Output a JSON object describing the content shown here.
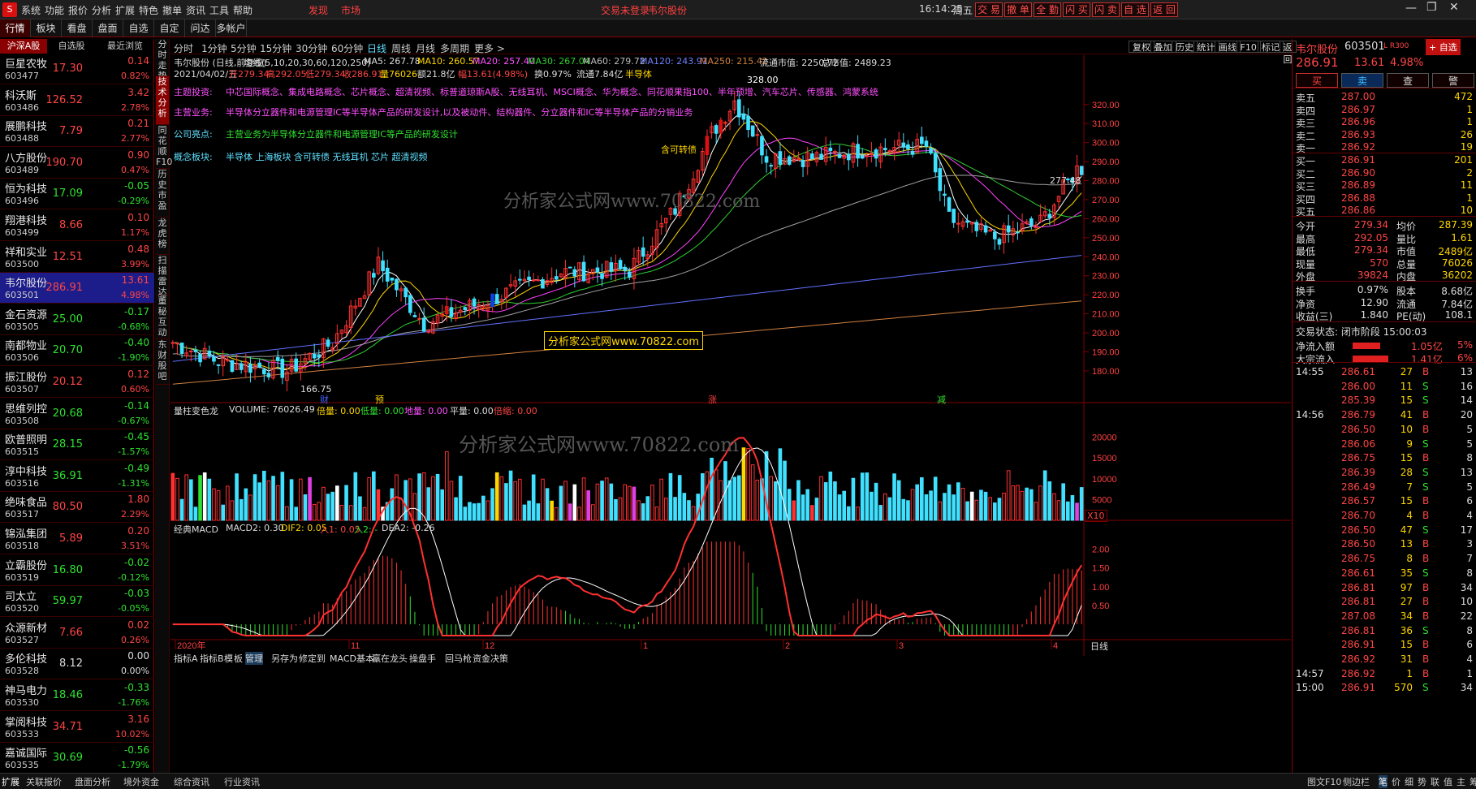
{
  "menu": {
    "items": [
      "系统",
      "功能",
      "报价",
      "分析",
      "扩展",
      "特色",
      "撤单",
      "资讯",
      "工具",
      "帮助"
    ],
    "discover": "发现",
    "market": "市场",
    "login": "交易未登录",
    "stock": "韦尔股份",
    "time": "16:14:25",
    "weekday": "周五",
    "actions": [
      "交 易",
      "撤 单",
      "全 勤",
      "闪 买",
      "闪 卖",
      "自 选",
      "返 回"
    ]
  },
  "tabs": [
    "行情",
    "板块",
    "看盘",
    "盘面",
    "自选",
    "自定",
    "问达",
    "多帐户"
  ],
  "left": {
    "headers": [
      "沪深A股",
      "自选股",
      "最近浏览"
    ],
    "stocks": [
      {
        "name": "巨星农牧",
        "code": "603477",
        "price": "17.30",
        "chg": "0.14",
        "pct": "0.82%",
        "dir": "up"
      },
      {
        "name": "科沃斯",
        "code": "603486",
        "price": "126.52",
        "chg": "3.42",
        "pct": "2.78%",
        "dir": "up"
      },
      {
        "name": "展鹏科技",
        "code": "603488",
        "price": "7.79",
        "chg": "0.21",
        "pct": "2.77%",
        "dir": "up"
      },
      {
        "name": "八方股份",
        "code": "603489",
        "price": "190.70",
        "chg": "0.90",
        "pct": "0.47%",
        "dir": "up"
      },
      {
        "name": "恒为科技",
        "code": "603496",
        "price": "17.09",
        "chg": "-0.05",
        "pct": "-0.29%",
        "dir": "dn"
      },
      {
        "name": "翔港科技",
        "code": "603499",
        "price": "8.66",
        "chg": "0.10",
        "pct": "1.17%",
        "dir": "up"
      },
      {
        "name": "祥和实业",
        "code": "603500",
        "price": "12.51",
        "chg": "0.48",
        "pct": "3.99%",
        "dir": "up"
      },
      {
        "name": "韦尔股份",
        "code": "603501",
        "price": "286.91",
        "chg": "13.61",
        "pct": "4.98%",
        "dir": "up"
      },
      {
        "name": "金石资源",
        "code": "603505",
        "price": "25.00",
        "chg": "-0.17",
        "pct": "-0.68%",
        "dir": "dn"
      },
      {
        "name": "南都物业",
        "code": "603506",
        "price": "20.70",
        "chg": "-0.40",
        "pct": "-1.90%",
        "dir": "dn"
      },
      {
        "name": "振江股份",
        "code": "603507",
        "price": "20.12",
        "chg": "0.12",
        "pct": "0.60%",
        "dir": "up"
      },
      {
        "name": "思维列控",
        "code": "603508",
        "price": "20.68",
        "chg": "-0.14",
        "pct": "-0.67%",
        "dir": "dn"
      },
      {
        "name": "欧普照明",
        "code": "603515",
        "price": "28.15",
        "chg": "-0.45",
        "pct": "-1.57%",
        "dir": "dn"
      },
      {
        "name": "淳中科技",
        "code": "603516",
        "price": "36.91",
        "chg": "-0.49",
        "pct": "-1.31%",
        "dir": "dn"
      },
      {
        "name": "绝味食品",
        "code": "603517",
        "price": "80.50",
        "chg": "1.80",
        "pct": "2.29%",
        "dir": "up"
      },
      {
        "name": "锦泓集团",
        "code": "603518",
        "price": "5.89",
        "chg": "0.20",
        "pct": "3.51%",
        "dir": "up"
      },
      {
        "name": "立霸股份",
        "code": "603519",
        "price": "16.80",
        "chg": "-0.02",
        "pct": "-0.12%",
        "dir": "dn"
      },
      {
        "name": "司太立",
        "code": "603520",
        "price": "59.97",
        "chg": "-0.03",
        "pct": "-0.05%",
        "dir": "dn"
      },
      {
        "name": "众源新材",
        "code": "603527",
        "price": "7.66",
        "chg": "0.02",
        "pct": "0.26%",
        "dir": "up"
      },
      {
        "name": "多伦科技",
        "code": "603528",
        "price": "8.12",
        "chg": "0.00",
        "pct": "0.00%",
        "dir": "wh"
      },
      {
        "name": "神马电力",
        "code": "603530",
        "price": "18.46",
        "chg": "-0.33",
        "pct": "-1.76%",
        "dir": "dn"
      },
      {
        "name": "掌阅科技",
        "code": "603533",
        "price": "34.71",
        "chg": "3.16",
        "pct": "10.02%",
        "dir": "up"
      },
      {
        "name": "嘉诚国际",
        "code": "603535",
        "price": "30.69",
        "chg": "-0.56",
        "pct": "-1.79%",
        "dir": "dn"
      }
    ]
  },
  "vtabs": [
    "分时走势",
    "技术分析",
    "同花顺F10",
    "历史市盈",
    "龙虎榜",
    "扫描雷达",
    "董秘互动",
    "东财股吧"
  ],
  "period": {
    "items": [
      "分时",
      "1分钟",
      "5分钟",
      "15分钟",
      "30分钟",
      "60分钟",
      "日线",
      "周线",
      "月线",
      "多周期",
      "更多 >"
    ],
    "selected": "日线",
    "right": [
      "复权",
      "叠加",
      "历史",
      "统计",
      "画线",
      "F10",
      "标记",
      "返回"
    ]
  },
  "info": {
    "line1_name": "韦尔股份 (日线,前复权)",
    "ma_label": "均线(5,10,20,30,60,120,250)",
    "ma5": "MA5: 267.78",
    "ma10": "MA10: 260.57",
    "ma20": "MA20: 257.40",
    "ma30": "MA30: 267.04",
    "ma60": "MA60: 279.72",
    "ma120": "MA120: 243.91",
    "ma250": "MA250: 215.42",
    "cap1": "流通市值: 2250.72",
    "cap2": "总市值: 2489.23",
    "line2": "2021/04/02/五",
    "open": "开279.34",
    "high": "高292.05",
    "low": "低279.34",
    "close": "收286.91",
    "vol": "量76026",
    "amt": "额21.8亿",
    "rng": "幅13.61(4.98%)",
    "turn": "换0.97%",
    "float": "流通7.84亿",
    "sector": "半导体"
  },
  "notes": [
    {
      "label": "主题投资:",
      "text": "中芯国际概念、集成电路概念、芯片概念、超清视频、标普道琼斯A股、无线耳机、MSCI概念、华为概念、同花顺果指100、半年预增、汽车芯片、传感器、鸿蒙系统"
    },
    {
      "label": "主营业务:",
      "text": "半导体分立器件和电源管理IC等半导体产品的研发设计,以及被动件、结构器件、分立器件和IC等半导体产品的分销业务"
    },
    {
      "label": "公司亮点:",
      "text": "主营业务为半导体分立器件和电源管理IC等产品的研发设计"
    },
    {
      "label": "概念板块:",
      "text": "半导体 上海板块 含可转债 无线耳机 芯片 超清视频"
    }
  ],
  "chart_marks": {
    "high": "328.00",
    "low": "166.75",
    "last": "277.48",
    "convertible": "含可转债",
    "watermark1": "分析家公式网www.70822.com",
    "watermark2": "分析家公式网www.70822.com",
    "watermark3": "分析家公式网www.70822.com",
    "events": [
      "财",
      "预",
      "涨",
      "减"
    ]
  },
  "price_axis": [
    "320.00",
    "310.00",
    "300.00",
    "290.00",
    "280.00",
    "270.00",
    "260.00",
    "250.00",
    "240.00",
    "230.00",
    "220.00",
    "210.00",
    "200.00",
    "190.00",
    "180.00"
  ],
  "vol_info": {
    "title": "量柱变色龙",
    "volume": "VOLUME: 76026.49",
    "bei": "倍量: 0.00",
    "di": "低量: 0.00",
    "di2": "地量: 0.00",
    "ping": "平量: 0.00",
    "bei2": "倍缩: 0.00",
    "axis": [
      "20000",
      "15000",
      "10000",
      "5000"
    ],
    "unit": "X10"
  },
  "macd_info": {
    "title": "经典MACD",
    "macd2": "MACD2: 0.30",
    "dif2": "DIF2: 0.05",
    "ru1": "入1: 0.05",
    "ru2": "入2: -",
    "dea2": "DEA2: -0.26",
    "axis": [
      "2.00",
      "1.50",
      "1.00",
      "0.50"
    ]
  },
  "x_axis": {
    "labels": [
      "2020年",
      "11",
      "12",
      "1",
      "2",
      "3",
      "4"
    ],
    "period": "日线"
  },
  "bottom_tabs": [
    "指标A",
    "指标B",
    "模",
    "板",
    "管理",
    "另存为",
    "修定到",
    "MACD基本",
    "羸在龙头",
    "操盘手",
    "回马枪",
    "资金决策"
  ],
  "right": {
    "name": "韦尔股份",
    "code": "603501",
    "flag": "L R300",
    "add": "+ 自选",
    "price": "286.91",
    "chg": "13.61",
    "pct": "4.98%",
    "btns": [
      "买",
      "卖",
      "查",
      "警"
    ],
    "asks": [
      {
        "l": "卖五",
        "p": "287.00",
        "v": "472"
      },
      {
        "l": "卖四",
        "p": "286.97",
        "v": "1"
      },
      {
        "l": "卖三",
        "p": "286.96",
        "v": "1"
      },
      {
        "l": "卖二",
        "p": "286.93",
        "v": "26"
      },
      {
        "l": "卖一",
        "p": "286.92",
        "v": "19"
      }
    ],
    "bids": [
      {
        "l": "买一",
        "p": "286.91",
        "v": "201"
      },
      {
        "l": "买二",
        "p": "286.90",
        "v": "2"
      },
      {
        "l": "买三",
        "p": "286.89",
        "v": "11"
      },
      {
        "l": "买四",
        "p": "286.88",
        "v": "1"
      },
      {
        "l": "买五",
        "p": "286.86",
        "v": "10"
      }
    ],
    "stats": [
      [
        "今开",
        "279.34",
        "均价",
        "287.39"
      ],
      [
        "最高",
        "292.05",
        "量比",
        "1.61"
      ],
      [
        "最低",
        "279.34",
        "市值",
        "2489亿"
      ],
      [
        "现量",
        "570",
        "总量",
        "76026"
      ],
      [
        "外盘",
        "39824",
        "内盘",
        "36202"
      ]
    ],
    "stats2": [
      [
        "换手",
        "0.97%",
        "股本",
        "8.68亿"
      ],
      [
        "净资",
        "12.90",
        "流通",
        "7.84亿"
      ],
      [
        "收益(三)",
        "1.840",
        "PE(动)",
        "108.1"
      ]
    ],
    "state": "交易状态: 闭市阶段 15:00:03",
    "flow": [
      {
        "l": "净流入额",
        "v": "1.05亿",
        "p": "5%"
      },
      {
        "l": "大宗流入",
        "v": "1.41亿",
        "p": "6%"
      }
    ],
    "ticks": [
      [
        "14:55",
        "286.61",
        "27",
        "B",
        "13"
      ],
      [
        "",
        "286.00",
        "11",
        "S",
        "16"
      ],
      [
        "",
        "285.39",
        "15",
        "S",
        "14"
      ],
      [
        "14:56",
        "286.79",
        "41",
        "B",
        "20"
      ],
      [
        "",
        "286.50",
        "10",
        "B",
        "5"
      ],
      [
        "",
        "286.06",
        "9",
        "S",
        "5"
      ],
      [
        "",
        "286.75",
        "15",
        "B",
        "8"
      ],
      [
        "",
        "286.39",
        "28",
        "S",
        "13"
      ],
      [
        "",
        "286.49",
        "7",
        "S",
        "5"
      ],
      [
        "",
        "286.57",
        "15",
        "B",
        "6"
      ],
      [
        "",
        "286.70",
        "4",
        "B",
        "4"
      ],
      [
        "",
        "286.50",
        "47",
        "S",
        "17"
      ],
      [
        "",
        "286.50",
        "13",
        "B",
        "3"
      ],
      [
        "",
        "286.75",
        "8",
        "B",
        "7"
      ],
      [
        "",
        "286.61",
        "35",
        "S",
        "8"
      ],
      [
        "",
        "286.81",
        "97",
        "B",
        "34"
      ],
      [
        "",
        "286.81",
        "27",
        "B",
        "10"
      ],
      [
        "",
        "287.08",
        "34",
        "B",
        "22"
      ],
      [
        "",
        "286.81",
        "36",
        "S",
        "8"
      ],
      [
        "",
        "286.91",
        "15",
        "B",
        "6"
      ],
      [
        "",
        "286.92",
        "31",
        "B",
        "4"
      ],
      [
        "14:57",
        "286.92",
        "1",
        "B",
        "1"
      ],
      [
        "15:00",
        "286.91",
        "570",
        "S",
        "34"
      ]
    ]
  },
  "status": {
    "items": [
      "扩展",
      "关联报价",
      "盘面分析",
      "境外资金",
      "综合资讯",
      "行业资讯"
    ],
    "right": [
      "图文F10",
      "侧边栏",
      "笔",
      "价",
      "细",
      "势",
      "联",
      "值",
      "主",
      "筹"
    ]
  },
  "chart_data": {
    "type": "candlestick",
    "price_range": [
      166.75,
      328.0
    ],
    "high_marker": 328.0,
    "low_marker": 166.75,
    "last_marker": 277.48,
    "volume_axis": [
      5000,
      10000,
      15000,
      20000
    ],
    "macd_axis": [
      0.5,
      1.0,
      1.5,
      2.0
    ],
    "latest": {
      "date": "2021/04/02",
      "open": 279.34,
      "high": 292.05,
      "low": 279.34,
      "close": 286.91,
      "volume": 76026
    },
    "ma": {
      "MA5": 267.78,
      "MA10": 260.57,
      "MA20": 257.4,
      "MA30": 267.04,
      "MA60": 279.72,
      "MA120": 243.91,
      "MA250": 215.42
    }
  }
}
